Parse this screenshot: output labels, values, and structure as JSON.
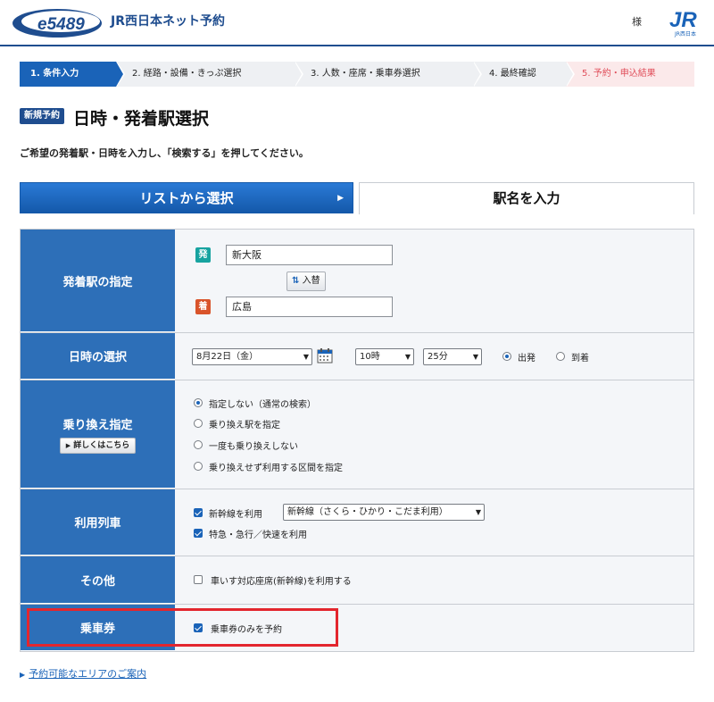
{
  "header": {
    "logo_text": "e5489",
    "site_title": "JR西日本ネット予約",
    "user_suffix": "様",
    "jr_logo_text": "JR",
    "jr_logo_sub": "JR西日本",
    "colors": {
      "brand": "#1f4d8f",
      "accent": "#1a63b8",
      "alert": "#e3262e"
    }
  },
  "steps": [
    {
      "label": "1. 条件入力",
      "state": "active"
    },
    {
      "label": "2. 経路・設備・きっぷ選択",
      "state": "todo"
    },
    {
      "label": "3. 人数・座席・乗車券選択",
      "state": "todo"
    },
    {
      "label": "4. 最終確認",
      "state": "todo"
    },
    {
      "label": "5. 予約・申込結果",
      "state": "todo"
    }
  ],
  "page": {
    "badge": "新規予約",
    "title": "日時・発着駅選択",
    "instructions": "ご希望の発着駅・日時を入力し、「検索する」を押してください。"
  },
  "tabs": {
    "list_label": "リストから選択",
    "input_label": "駅名を入力"
  },
  "form": {
    "stations": {
      "label": "発着駅の指定",
      "from_tag": "発",
      "from_value": "新大阪",
      "swap_label": "入替",
      "to_tag": "着",
      "to_value": "広島"
    },
    "datetime": {
      "label": "日時の選択",
      "date_value": "8月22日（金）",
      "hour_value": "10時",
      "minute_value": "25分",
      "departure_label": "出発",
      "arrival_label": "到着",
      "selected": "出発"
    },
    "transfer": {
      "label": "乗り換え指定",
      "detail_button": "詳しくはこちら",
      "options": [
        "指定しない（通常の検索）",
        "乗り換え駅を指定",
        "一度も乗り換えしない",
        "乗り換えせず利用する区間を指定"
      ],
      "selected_index": 0
    },
    "trains": {
      "label": "利用列車",
      "shinkansen_label": "新幹線を利用",
      "shinkansen_checked": true,
      "shinkansen_select": "新幹線（さくら・ひかり・こだま利用）",
      "express_label": "特急・急行／快速を利用",
      "express_checked": true
    },
    "other": {
      "label": "その他",
      "wheelchair_label": "車いす対応座席(新幹線)を利用する",
      "wheelchair_checked": false
    },
    "ticket": {
      "label": "乗車券",
      "ticket_only_label": "乗車券のみを予約",
      "ticket_only_checked": true
    }
  },
  "footer": {
    "area_link": "予約可能なエリアのご案内"
  }
}
